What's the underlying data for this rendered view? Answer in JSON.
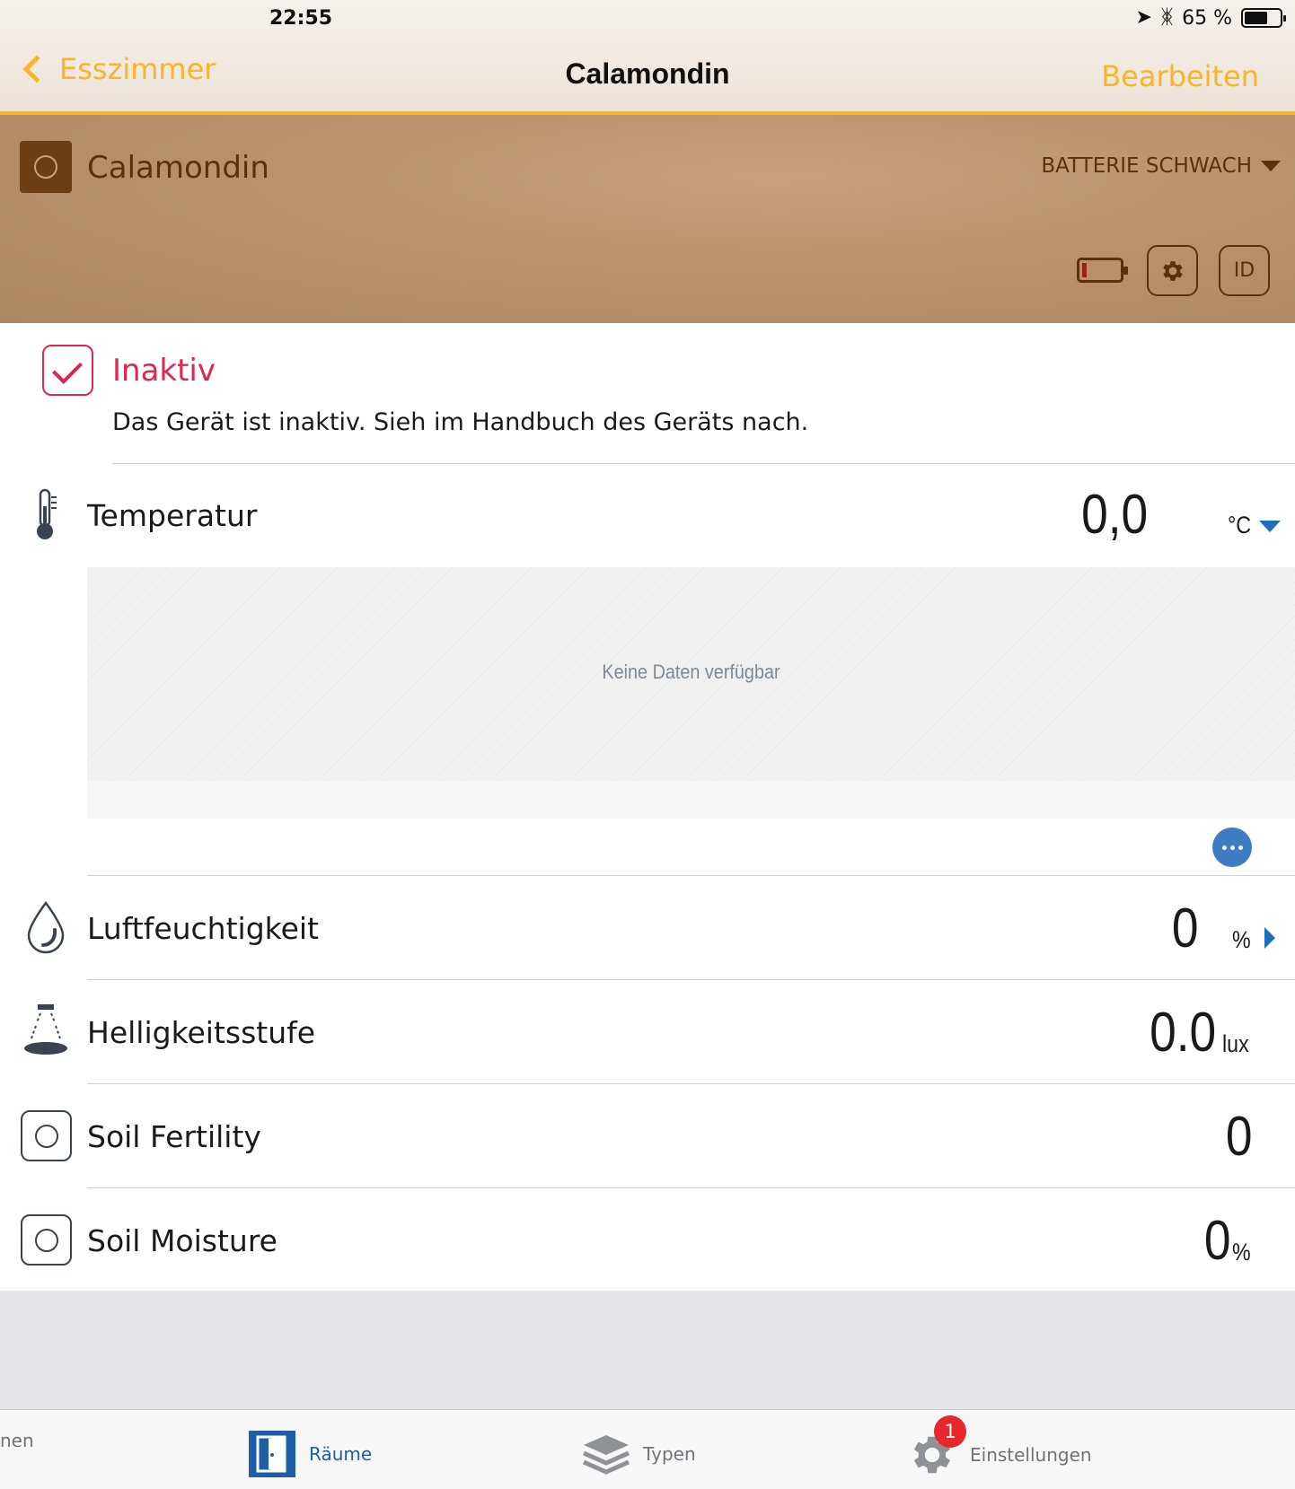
{
  "status_bar": {
    "time": "22:55",
    "battery_percent": "65 %"
  },
  "nav": {
    "back_label": "Esszimmer",
    "title": "Calamondin",
    "edit_label": "Bearbeiten"
  },
  "device": {
    "name": "Calamondin",
    "battery_status": "BATTERIE SCHWACH",
    "id_label": "ID"
  },
  "notice": {
    "title": "Inaktiv",
    "text": "Das Gerät ist inaktiv. Sieh im Handbuch des Geräts nach."
  },
  "sensors": [
    {
      "label": "Temperatur",
      "value": "0,0",
      "unit": "°C",
      "icon": "thermometer-icon"
    },
    {
      "label": "Luftfeuchtigkeit",
      "value": "0",
      "unit": "%",
      "icon": "water-drop-icon"
    },
    {
      "label": "Helligkeitsstufe",
      "value": "0.0",
      "unit": "lux",
      "icon": "lamp-icon"
    },
    {
      "label": "Soil Fertility",
      "value": "0",
      "unit": "",
      "icon": "circle-square-icon"
    },
    {
      "label": "Soil Moisture",
      "value": "0",
      "unit": "%",
      "icon": "circle-square-icon"
    }
  ],
  "chart": {
    "empty_text": "Keine Daten verfügbar"
  },
  "tabs": [
    {
      "label": "nen"
    },
    {
      "label": "Räume",
      "active": true
    },
    {
      "label": "Typen"
    },
    {
      "label": "Einstellungen",
      "badge": "1"
    }
  ],
  "colors": {
    "accent": "#f7b529",
    "alert": "#e0264f",
    "link_blue": "#1d6fb8",
    "brown": "#5b300a"
  }
}
